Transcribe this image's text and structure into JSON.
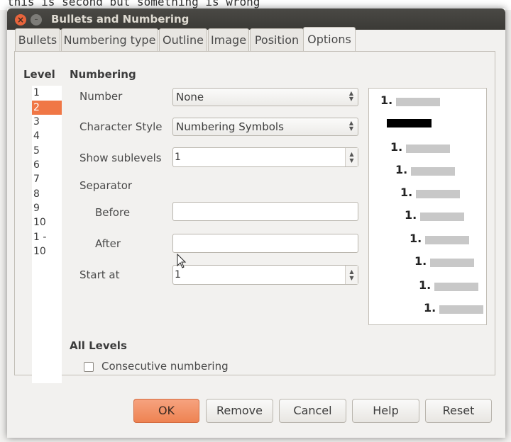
{
  "background": {
    "text": "this is second but something is wrong"
  },
  "window": {
    "title": "Bullets and Numbering"
  },
  "tabs": [
    {
      "label": "Bullets",
      "active": false
    },
    {
      "label": "Numbering type",
      "active": false
    },
    {
      "label": "Outline",
      "active": false
    },
    {
      "label": "Image",
      "active": false
    },
    {
      "label": "Position",
      "active": false
    },
    {
      "label": "Options",
      "active": true
    }
  ],
  "level": {
    "heading": "Level",
    "items": [
      "1",
      "2",
      "3",
      "4",
      "5",
      "6",
      "7",
      "8",
      "9",
      "10",
      "1 - 10"
    ],
    "selected": "2"
  },
  "numbering": {
    "heading": "Numbering",
    "number_label": "Number",
    "number_value": "None",
    "char_style_label": "Character Style",
    "char_style_value": "Numbering Symbols",
    "show_sublevels_label": "Show sublevels",
    "show_sublevels_value": "1",
    "separator_label": "Separator",
    "before_label": "Before",
    "before_value": "",
    "after_label": "After",
    "after_value": "",
    "start_at_label": "Start at",
    "start_at_value": "1"
  },
  "preview": {
    "numbers": [
      "1.",
      "1.",
      "1.",
      "1.",
      "1.",
      "1.",
      "1.",
      "1.",
      "1."
    ]
  },
  "all_levels": {
    "heading": "All Levels",
    "consecutive_label": "Consecutive numbering",
    "consecutive_checked": false
  },
  "buttons": {
    "ok": "OK",
    "remove": "Remove",
    "cancel": "Cancel",
    "help": "Help",
    "reset": "Reset"
  },
  "colors": {
    "accent": "#f07746",
    "titlebar": "#3b3a36",
    "close": "#e7643c"
  }
}
